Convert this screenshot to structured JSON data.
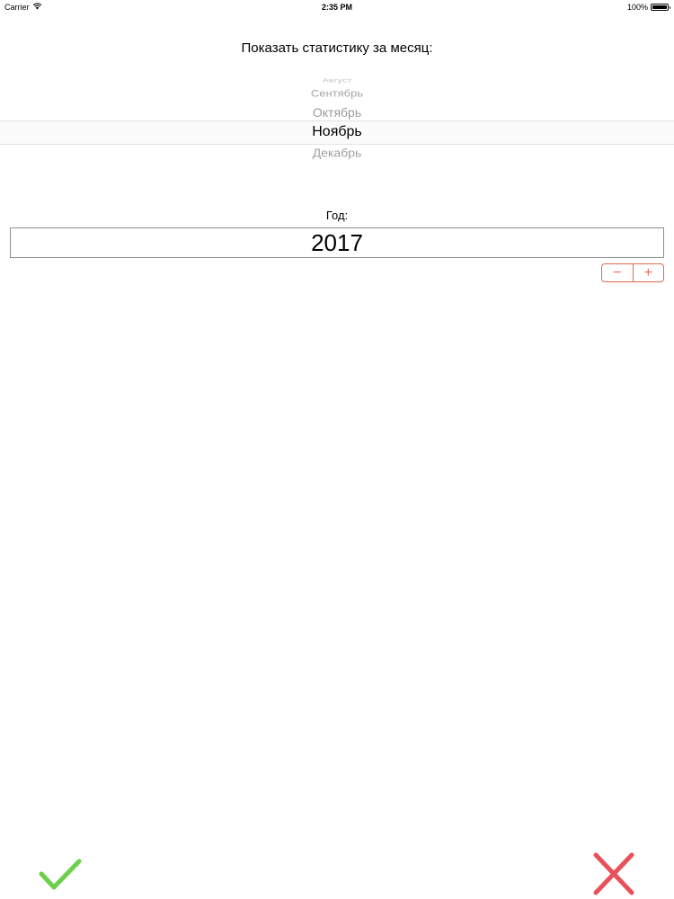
{
  "status_bar": {
    "carrier": "Carrier",
    "time": "2:35 PM",
    "battery": "100%",
    "wifi_icon": "wifi-icon",
    "battery_icon": "battery-icon"
  },
  "month_picker": {
    "title": "Показать статистику за месяц:",
    "items": [
      "Август",
      "Сентябрь",
      "Октябрь",
      "Ноябрь",
      "Декабрь"
    ],
    "selected": "Ноябрь"
  },
  "year": {
    "label": "Год:",
    "value": "2017",
    "decrement_label": "−",
    "increment_label": "+"
  },
  "actions": {
    "confirm_icon": "checkmark-icon",
    "cancel_icon": "close-icon"
  },
  "colors": {
    "accent": "#e36b4f",
    "confirm": "#6cd04a",
    "cancel": "#e8505b"
  }
}
